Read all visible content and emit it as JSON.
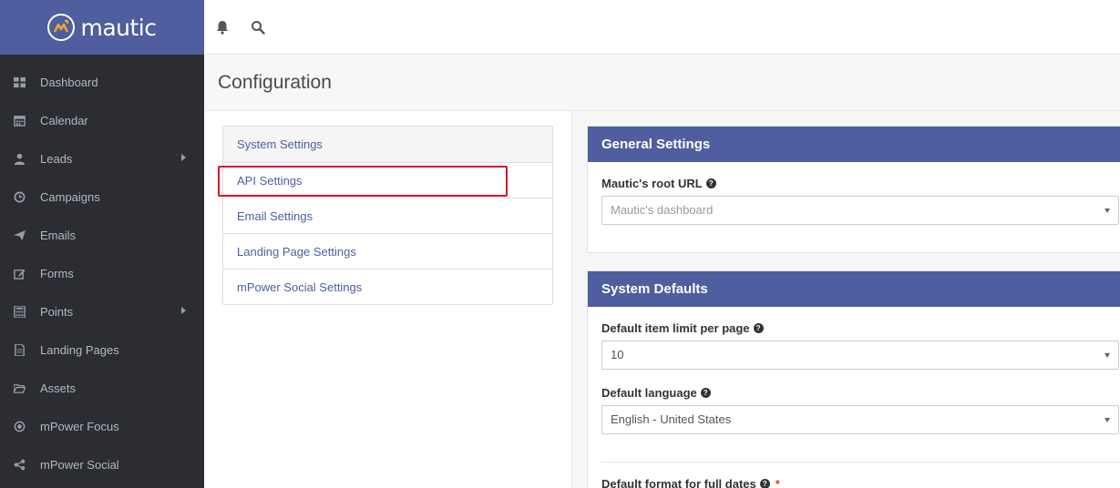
{
  "brand": {
    "name": "mautic"
  },
  "sidebar": {
    "items": [
      {
        "label": "Dashboard",
        "icon": "dashboard-icon",
        "has_submenu": false
      },
      {
        "label": "Calendar",
        "icon": "calendar-icon",
        "has_submenu": false
      },
      {
        "label": "Leads",
        "icon": "user-icon",
        "has_submenu": true
      },
      {
        "label": "Campaigns",
        "icon": "clock-icon",
        "has_submenu": false
      },
      {
        "label": "Emails",
        "icon": "send-icon",
        "has_submenu": false
      },
      {
        "label": "Forms",
        "icon": "edit-icon",
        "has_submenu": false
      },
      {
        "label": "Points",
        "icon": "calculator-icon",
        "has_submenu": true
      },
      {
        "label": "Landing Pages",
        "icon": "file-icon",
        "has_submenu": false
      },
      {
        "label": "Assets",
        "icon": "folder-open-icon",
        "has_submenu": false
      },
      {
        "label": "mPower Focus",
        "icon": "dot-circle-icon",
        "has_submenu": false
      },
      {
        "label": "mPower Social",
        "icon": "share-icon",
        "has_submenu": false
      }
    ]
  },
  "header": {
    "icons": [
      "bell-icon",
      "search-icon"
    ]
  },
  "page": {
    "title": "Configuration"
  },
  "settings_nav": {
    "items": [
      {
        "label": "System Settings"
      },
      {
        "label": "API Settings",
        "highlighted": true
      },
      {
        "label": "Email Settings"
      },
      {
        "label": "Landing Page Settings"
      },
      {
        "label": "mPower Social Settings"
      }
    ]
  },
  "general_settings": {
    "heading": "General Settings",
    "root_url_label": "Mautic's root URL",
    "root_url_value": "Mautic's dashboard"
  },
  "system_defaults": {
    "heading": "System Defaults",
    "item_limit_label": "Default item limit per page",
    "item_limit_value": "10",
    "language_label": "Default language",
    "language_value": "English - United States",
    "date_format_label": "Default format for full dates"
  },
  "colors": {
    "brand": "#4e5e9e",
    "sidebar_bg": "#2b2d33",
    "highlight": "#d9112a"
  }
}
